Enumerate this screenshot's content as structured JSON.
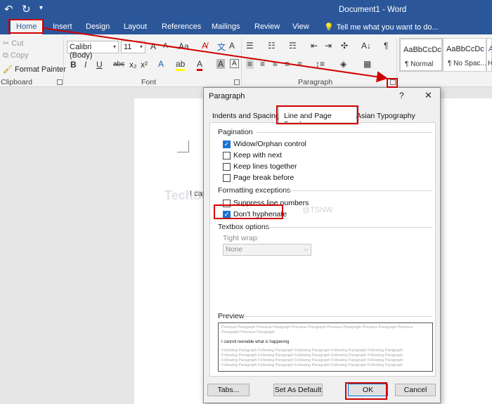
{
  "titlebar": {
    "title": "Document1 - Word"
  },
  "menu": {
    "tabs": [
      "Home",
      "Insert",
      "Design",
      "Layout",
      "References",
      "Mailings",
      "Review",
      "View"
    ],
    "tell_me": "Tell me what you want to do..."
  },
  "ribbon": {
    "clipboard": {
      "cut": "Cut",
      "copy": "Copy",
      "format_painter": "Format Painter",
      "label": "Clipboard"
    },
    "font": {
      "name": "Calibri (Body)",
      "size": "11",
      "label": "Font",
      "grow": "A",
      "shrink": "A",
      "case": "Aa",
      "bold": "B",
      "italic": "I",
      "underline": "U",
      "strike": "abc",
      "sub": "x₂",
      "sup": "x²"
    },
    "paragraph": {
      "label": "Paragraph",
      "pilcrow": "¶"
    },
    "styles": [
      {
        "sample": "AaBbCcDc",
        "name": "¶ Normal"
      },
      {
        "sample": "AaBbCcDc",
        "name": "¶ No Spac..."
      },
      {
        "sample": "A",
        "name": "H"
      }
    ]
  },
  "document": {
    "text": "I can"
  },
  "dialog": {
    "title": "Paragraph",
    "help": "?",
    "close": "✕",
    "tabs": [
      "Indents and Spacing",
      "Line and Page Breaks",
      "Asian Typography"
    ],
    "pagination": {
      "label": "Pagination",
      "options": [
        {
          "label": "Widow/Orphan control",
          "checked": true
        },
        {
          "label": "Keep with next",
          "checked": false
        },
        {
          "label": "Keep lines together",
          "checked": false
        },
        {
          "label": "Page break before",
          "checked": false
        }
      ]
    },
    "formatting": {
      "label": "Formatting exceptions",
      "options": [
        {
          "label": "Suppress line numbers",
          "checked": false
        },
        {
          "label": "Don't hyphenate",
          "checked": true
        }
      ]
    },
    "textbox": {
      "label": "Textbox options",
      "tight_wrap_label": "Tight wrap:",
      "tight_wrap_value": "None"
    },
    "preview": {
      "label": "Preview",
      "previous": "Previous Paragraph Previous Paragraph Previous Paragraph Previous Paragraph Previous Paragraph Previous",
      "previous_short": "Paragraph Previous Paragraph",
      "sample": "I cannot reenable what is happening",
      "following": "Following Paragraph Following Paragraph Following Paragraph Following Paragraph Following Paragraph"
    },
    "buttons": {
      "tabs": "Tabs...",
      "default": "Set As Default",
      "ok": "OK",
      "cancel": "Cancel"
    }
  },
  "watermark": {
    "text": "TechSchoo.Net",
    "sub": "@TSNW"
  },
  "colors": {
    "titlebar": "#2b579a",
    "annotation": "#d00000",
    "checkbox": "#1a73d4"
  }
}
